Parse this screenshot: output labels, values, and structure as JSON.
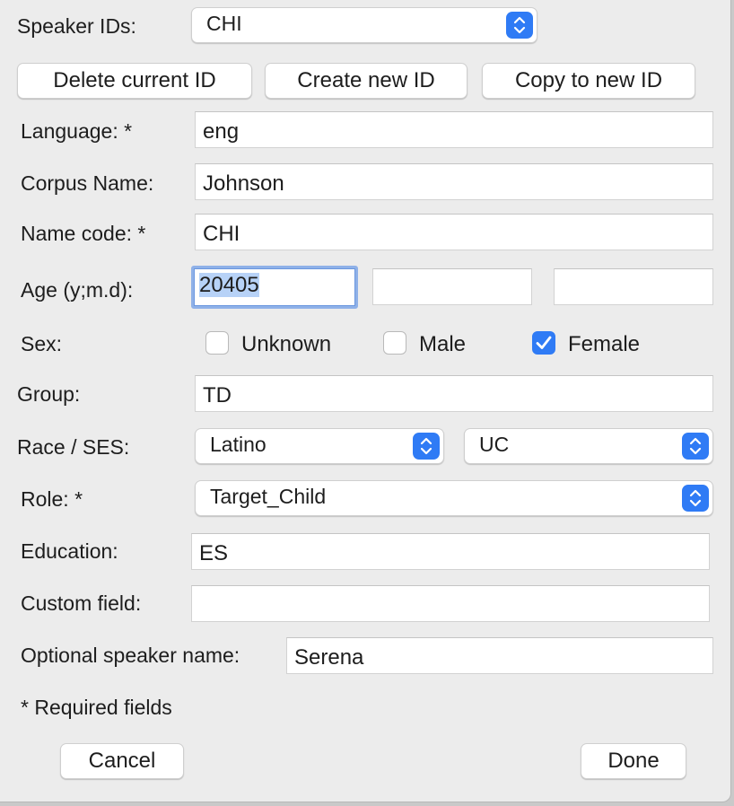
{
  "speaker_ids": {
    "label": "Speaker IDs:",
    "value": "CHI"
  },
  "buttons": {
    "delete": "Delete current ID",
    "create": "Create new ID",
    "copy": "Copy to new ID",
    "cancel": "Cancel",
    "done": "Done"
  },
  "fields": {
    "language": {
      "label": "Language: *",
      "value": "eng"
    },
    "corpus": {
      "label": "Corpus Name:",
      "value": "Johnson"
    },
    "name_code": {
      "label": "Name code: *",
      "value": "CHI"
    },
    "age": {
      "label": "Age (y;m.d):",
      "value1": "20405",
      "value2": "",
      "value3": ""
    },
    "group": {
      "label": "Group:",
      "value": "TD"
    },
    "education": {
      "label": "Education:",
      "value": "ES"
    },
    "custom": {
      "label": "Custom field:",
      "value": ""
    },
    "speaker_name": {
      "label": "Optional speaker name:",
      "value": "Serena"
    }
  },
  "sex": {
    "label": "Sex:",
    "options": [
      {
        "label": "Unknown",
        "checked": false
      },
      {
        "label": "Male",
        "checked": false
      },
      {
        "label": "Female",
        "checked": true
      }
    ]
  },
  "race_ses": {
    "label": "Race / SES:",
    "race": "Latino",
    "ses": "UC"
  },
  "role": {
    "label": "Role: *",
    "value": "Target_Child"
  },
  "footnote": "* Required fields",
  "colors": {
    "accent": "#2f7bf5",
    "focus_ring": "#8fb1e8",
    "selection": "#b7d2f7"
  },
  "icons": {
    "stepper": "chevron-up-down-icon",
    "check": "checkmark-icon"
  }
}
